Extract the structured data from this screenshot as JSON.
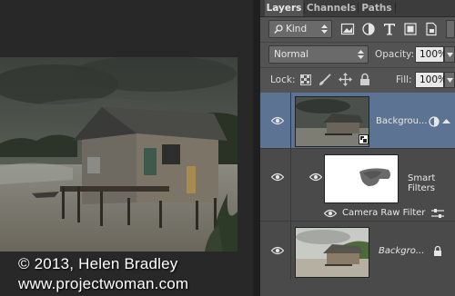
{
  "watermark": {
    "line1": "© 2013, Helen Bradley",
    "line2": "www.projectwoman.com"
  },
  "tabs": [
    {
      "label": "Layers",
      "active": true
    },
    {
      "label": "Channels",
      "active": false
    },
    {
      "label": "Paths",
      "active": false
    }
  ],
  "filter": {
    "kind_label": "Kind",
    "icons": [
      "pixel-filter-icon",
      "adjustment-filter-icon",
      "type-filter-icon",
      "shape-filter-icon",
      "smart-object-filter-icon"
    ]
  },
  "blend": {
    "mode": "Normal",
    "opacity_label": "Opacity:",
    "opacity_value": "100%"
  },
  "lock": {
    "label": "Lock:",
    "fill_label": "Fill:",
    "fill_value": "100%"
  },
  "layers": [
    {
      "name": "Backgrou...",
      "type": "smart-object",
      "selected": true
    },
    {
      "name": "Smart Filters",
      "type": "smart-filter-mask"
    },
    {
      "name": "Camera Raw Filter",
      "type": "filter"
    },
    {
      "name": "Backgro...",
      "type": "locked-background",
      "italic": true
    }
  ],
  "colors": {
    "panel": "#535353",
    "selected_layer": "#5c7394",
    "canvas_bg": "#282828"
  }
}
